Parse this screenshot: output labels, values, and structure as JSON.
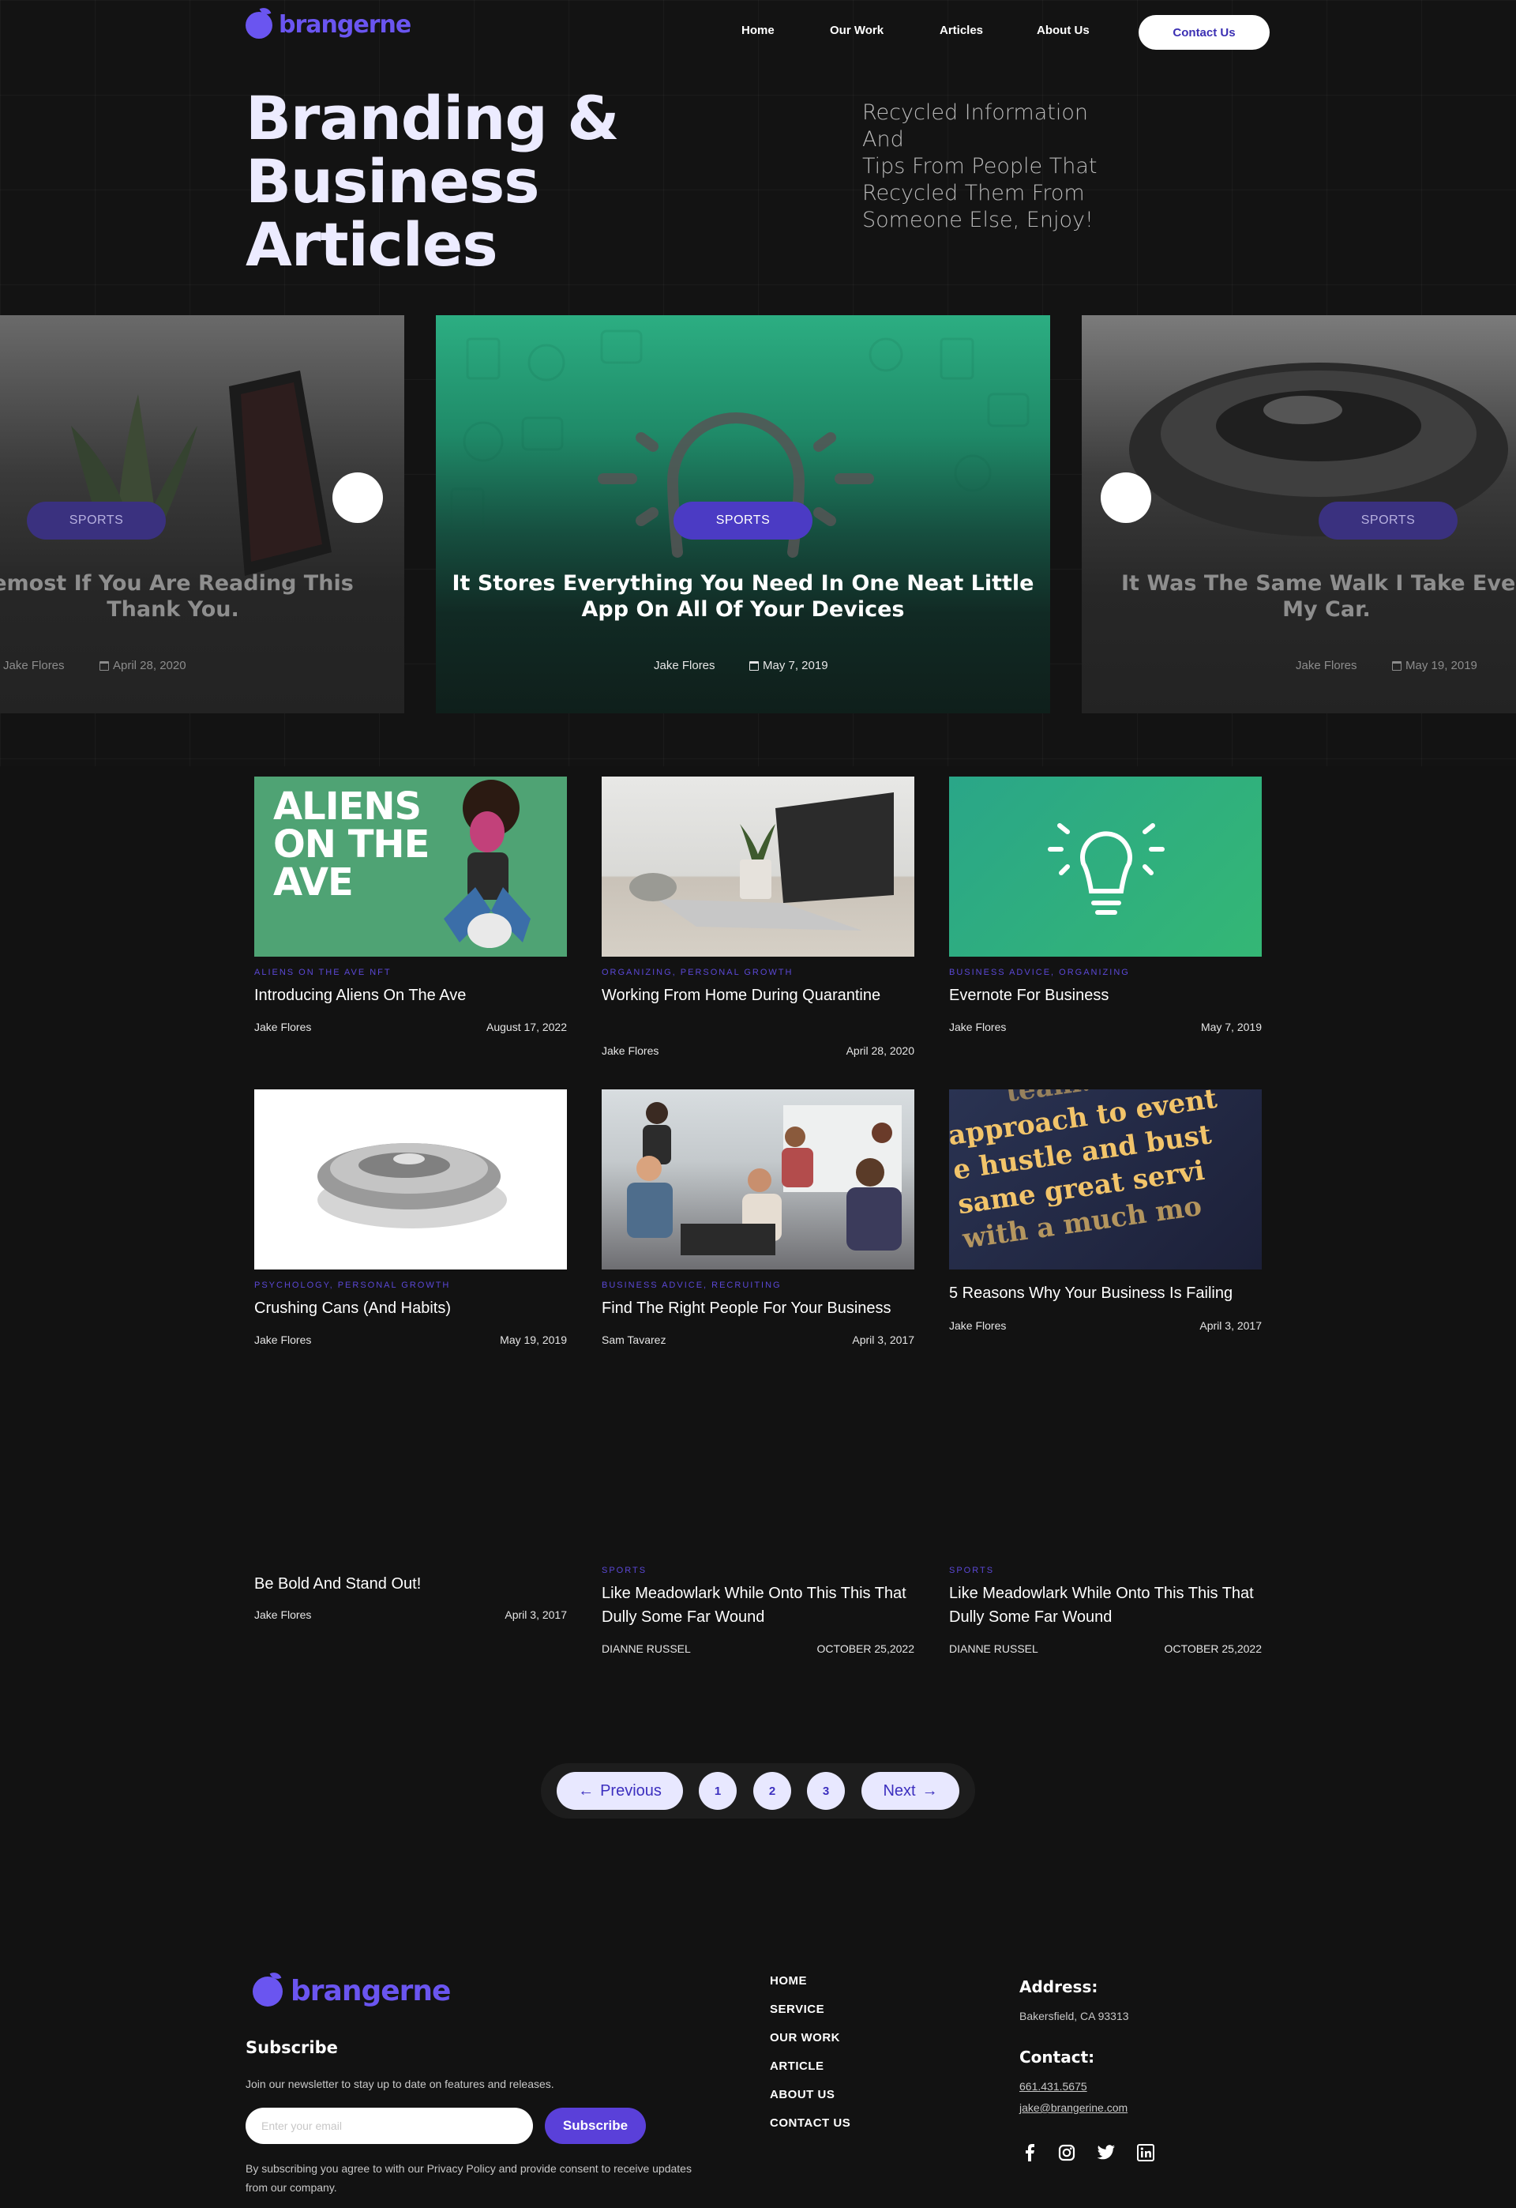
{
  "brand": {
    "name": "brangerne",
    "accent": "#6a55f0"
  },
  "nav": {
    "links": [
      "Home",
      "Our Work",
      "Articles",
      "About Us"
    ],
    "cta": "Contact Us"
  },
  "hero": {
    "title_lines": [
      "Branding &",
      "Business",
      "Articles"
    ],
    "subtitle_lines": [
      "Recycled Information And",
      "Tips From People That",
      "Recycled Them From",
      "Someone Else, Enjoy!"
    ]
  },
  "slider": [
    {
      "badge": "SPORTS",
      "title_lines": [
        "emost If You Are Reading This",
        "Thank You."
      ],
      "author": "Jake Flores",
      "date": "April 28, 2020"
    },
    {
      "badge": "SPORTS",
      "title_lines": [
        "It Stores Everything You Need In One Neat Little",
        "App On All Of Your Devices"
      ],
      "author": "Jake Flores",
      "date": "May 7, 2019"
    },
    {
      "badge": "SPORTS",
      "title_lines": [
        "It Was The Same Walk I Take Every",
        "My Car."
      ],
      "author": "Jake Flores",
      "date": "May 19, 2019"
    }
  ],
  "articles": [
    {
      "category": "ALIENS ON THE AVE NFT",
      "title": "Introducing Aliens On The Ave",
      "author": "Jake Flores",
      "date": "August 17, 2022",
      "image_text": [
        "ALIENS",
        "ON THE",
        "AVE"
      ]
    },
    {
      "category": "ORGANIZING, PERSONAL GROWTH",
      "title": "Working From Home During Quarantine",
      "author": "Jake Flores",
      "date": "April 28, 2020"
    },
    {
      "category": "BUSINESS ADVICE, ORGANIZING",
      "title": "Evernote For Business",
      "author": "Jake Flores",
      "date": "May 7, 2019"
    },
    {
      "category": "PSYCHOLOGY, PERSONAL GROWTH",
      "title": "Crushing Cans (And Habits)",
      "author": "Jake Flores",
      "date": "May 19, 2019"
    },
    {
      "category": "BUSINESS ADVICE, RECRUITING",
      "title": "Find The Right People For Your Business",
      "author": "Sam Tavarez",
      "date": "April 3, 2017"
    },
    {
      "category": "",
      "title": "5 Reasons Why Your Business Is Failing",
      "author": "Jake Flores",
      "date": "April 3, 2017",
      "image_text": [
        "team.",
        "approach to event",
        "e hustle and bust",
        "same great servi",
        "with a much mo"
      ]
    },
    {
      "category": "",
      "title": "Be Bold And Stand Out!",
      "author": "Jake Flores",
      "date": "April 3, 2017"
    },
    {
      "category": "SPORTS",
      "title": "Like Meadowlark While Onto This This That Dully Some Far Wound",
      "author": "DIANNE RUSSEL",
      "date": "OCTOBER 25,2022"
    },
    {
      "category": "SPORTS",
      "title": "Like Meadowlark While Onto This This That Dully Some Far Wound",
      "author": "DIANNE RUSSEL",
      "date": "OCTOBER 25,2022"
    }
  ],
  "pagination": {
    "previous": "Previous",
    "next": "Next",
    "pages": [
      "1",
      "2",
      "3"
    ]
  },
  "footer": {
    "subscribe_title": "Subscribe",
    "subscribe_text": "Join our newsletter to stay up to date on features and releases.",
    "email_placeholder": "Enter your email",
    "subscribe_button": "Subscribe",
    "legal_lines": [
      "By subscribing you agree to with our Privacy Policy and provide consent to receive updates",
      "from our company."
    ],
    "links": [
      "HOME",
      "SERVICE",
      "OUR WORK",
      "ARTICLE",
      "ABOUT US",
      "CONTACT US"
    ],
    "address_title": "Address:",
    "address": "Bakersfield, CA 93313",
    "contact_title": "Contact:",
    "phone": "661.431.5675",
    "email": "jake@brangerine.com",
    "social_icons": [
      "facebook-icon",
      "instagram-icon",
      "twitter-icon",
      "linkedin-icon"
    ]
  }
}
